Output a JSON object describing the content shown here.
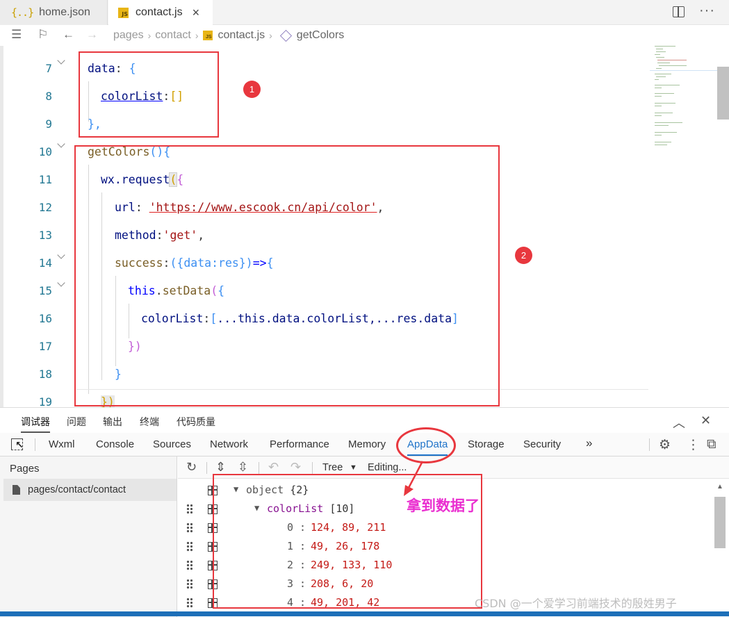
{
  "tabs": [
    {
      "label": "home.json",
      "icon": "json-icon",
      "glyph": "{..}"
    },
    {
      "label": "contact.js",
      "icon": "js-file-icon",
      "glyph": "JS"
    }
  ],
  "breadcrumb": [
    "pages",
    "contact",
    "contact.js",
    "getColors"
  ],
  "editor": {
    "line_numbers": [
      "7",
      "8",
      "9",
      "10",
      "11",
      "12",
      "13",
      "14",
      "15",
      "16",
      "17",
      "18",
      "19"
    ],
    "tokens": {
      "data": "data",
      "colon": ":",
      "colorList": "colorList",
      "empty_array": "[]",
      "brace_open": "{",
      "brace_close_comma": "},",
      "getColors": "getColors",
      "parens": "()",
      "wx_request": "wx.request",
      "paren_open": "(",
      "url": "url",
      "url_value": "'https://www.escook.cn/api/color'",
      "comma": ",",
      "method": "method",
      "method_value": "'get'",
      "success": "success",
      "arrow_params": "({data:res})",
      "arrow": "=>",
      "this": "this",
      "dot": ".",
      "setData": "setData",
      "colorList_key": "colorList",
      "spread_open": "[",
      "spread_body": "...this.data.colorList,...res.data",
      "spread_close": "]",
      "close_paren_brace": "})",
      "close_brace": "}",
      "line19_close": "})"
    }
  },
  "panel": {
    "tabs": [
      "调试器",
      "问题",
      "输出",
      "终端",
      "代码质量"
    ],
    "devtools_tabs": [
      "Wxml",
      "Console",
      "Sources",
      "Network",
      "Performance",
      "Memory",
      "AppData",
      "Storage",
      "Security",
      "»"
    ],
    "active_devtools_tab": "AppData",
    "pages_title": "Pages",
    "pages_item": "pages/contact/contact",
    "toolbar": {
      "tree_label": "Tree",
      "tree_arrow": "▼",
      "editing_label": "Editing..."
    },
    "tree": {
      "root_key": "object",
      "root_count": "{2}",
      "list_key": "colorList",
      "list_count": "[10]",
      "items": [
        {
          "index": "0",
          "value": "124, 89, 211"
        },
        {
          "index": "1",
          "value": "49, 26, 178"
        },
        {
          "index": "2",
          "value": "249, 133, 110"
        },
        {
          "index": "3",
          "value": "208, 6, 20"
        },
        {
          "index": "4",
          "value": "49, 201, 42"
        }
      ]
    }
  },
  "annotations": {
    "badge1": "1",
    "badge2": "2",
    "callout_text": "拿到数据了",
    "highlight_color": "#e8373e",
    "callout_color": "#ea2fd0"
  },
  "watermark": "CSDN @一个爱学习前端技术的殷姓男子"
}
